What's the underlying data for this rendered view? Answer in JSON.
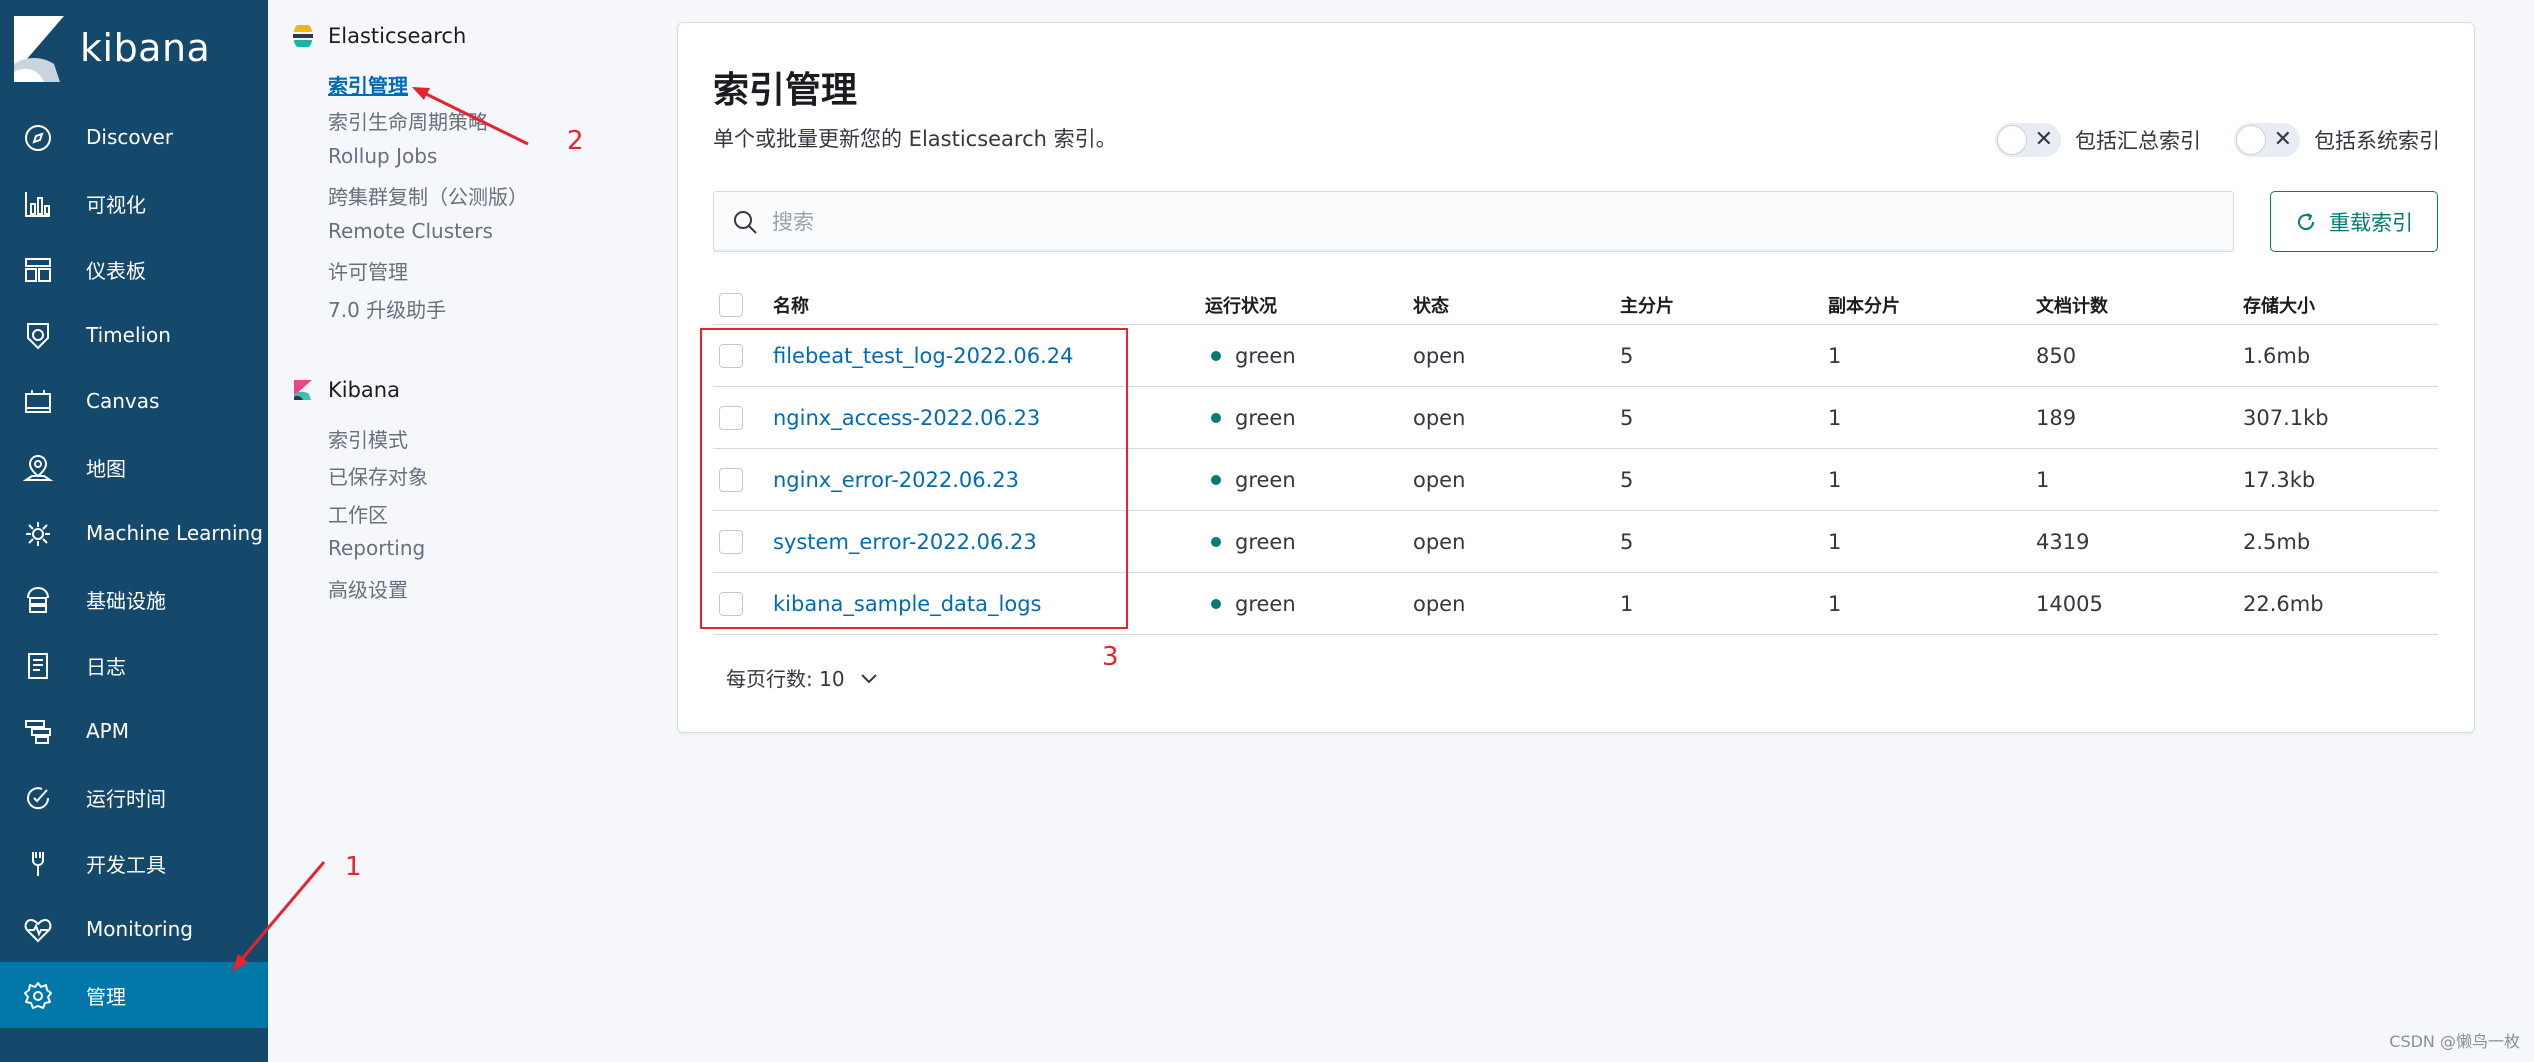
{
  "brand": {
    "name": "kibana"
  },
  "nav": {
    "items": [
      {
        "label": "Discover",
        "icon": "compass-icon"
      },
      {
        "label": "可视化",
        "icon": "visualize-icon"
      },
      {
        "label": "仪表板",
        "icon": "dashboard-icon"
      },
      {
        "label": "Timelion",
        "icon": "timelion-icon"
      },
      {
        "label": "Canvas",
        "icon": "canvas-icon"
      },
      {
        "label": "地图",
        "icon": "map-icon"
      },
      {
        "label": "Machine Learning",
        "icon": "ml-icon"
      },
      {
        "label": "基础设施",
        "icon": "infrastructure-icon"
      },
      {
        "label": "日志",
        "icon": "logs-icon"
      },
      {
        "label": "APM",
        "icon": "apm-icon"
      },
      {
        "label": "运行时间",
        "icon": "uptime-icon"
      },
      {
        "label": "开发工具",
        "icon": "devtools-icon"
      },
      {
        "label": "Monitoring",
        "icon": "monitoring-icon"
      },
      {
        "label": "管理",
        "icon": "gear-icon"
      }
    ],
    "active": "管理"
  },
  "subnav": {
    "elasticsearch": {
      "title": "Elasticsearch",
      "links": [
        "索引管理",
        "索引生命周期策略",
        "Rollup Jobs",
        "跨集群复制（公测版）",
        "Remote Clusters",
        "许可管理",
        "7.0 升级助手"
      ]
    },
    "kibana": {
      "title": "Kibana",
      "links": [
        "索引模式",
        "已保存对象",
        "工作区",
        "Reporting",
        "高级设置"
      ]
    }
  },
  "main": {
    "title": "索引管理",
    "description": "单个或批量更新您的 Elasticsearch 索引。",
    "toggles": {
      "rollup": "包括汇总索引",
      "system": "包括系统索引"
    },
    "search": {
      "placeholder": "搜索",
      "value": ""
    },
    "reload_label": "重载索引",
    "table": {
      "columns": [
        "名称",
        "运行状况",
        "状态",
        "主分片",
        "副本分片",
        "文档计数",
        "存储大小"
      ],
      "rows": [
        {
          "name": "filebeat_test_log-2022.06.24",
          "health": "green",
          "status": "open",
          "primary": "5",
          "replica": "1",
          "docs": "850",
          "size": "1.6mb"
        },
        {
          "name": "nginx_access-2022.06.23",
          "health": "green",
          "status": "open",
          "primary": "5",
          "replica": "1",
          "docs": "189",
          "size": "307.1kb"
        },
        {
          "name": "nginx_error-2022.06.23",
          "health": "green",
          "status": "open",
          "primary": "5",
          "replica": "1",
          "docs": "1",
          "size": "17.3kb"
        },
        {
          "name": "system_error-2022.06.23",
          "health": "green",
          "status": "open",
          "primary": "5",
          "replica": "1",
          "docs": "4319",
          "size": "2.5mb"
        },
        {
          "name": "kibana_sample_data_logs",
          "health": "green",
          "status": "open",
          "primary": "1",
          "replica": "1",
          "docs": "14005",
          "size": "22.6mb"
        }
      ]
    },
    "rows_per_page_label": "每页行数: 10"
  },
  "annotations": {
    "n1": "1",
    "n2": "2",
    "n3": "3"
  },
  "watermark": "CSDN @懒鸟一枚",
  "colors": {
    "sidebar": "#15496b",
    "sidebar_active": "#0077a8",
    "link": "#006bb4",
    "health_green": "#017d73",
    "annotation_red": "#e8232c"
  }
}
